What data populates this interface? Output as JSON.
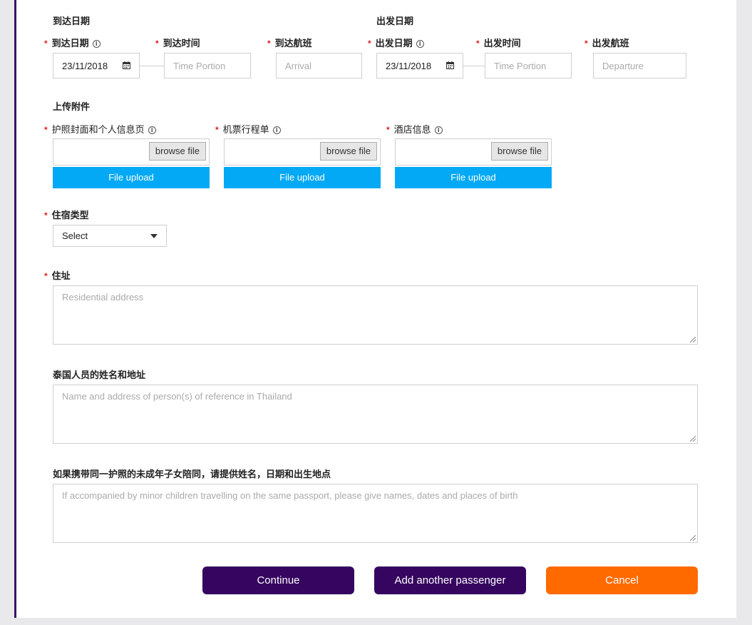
{
  "arrival": {
    "section_title": "到达日期",
    "date_label": "到达日期",
    "date_value": "23/11/2018",
    "time_label": "到达时间",
    "time_placeholder": "Time Portion",
    "flight_label": "到达航班",
    "flight_placeholder": "Arrival"
  },
  "departure": {
    "section_title": "出发日期",
    "date_label": "出发日期",
    "date_value": "23/11/2018",
    "time_label": "出发时间",
    "time_placeholder": "Time Portion",
    "flight_label": "出发航班",
    "flight_placeholder": "Departure"
  },
  "required_mark": "*",
  "info_glyph": "i",
  "attachments": {
    "section_title": "上传附件",
    "items": [
      {
        "label": "护照封面和个人信息页",
        "browse": "browse file",
        "upload": "File upload"
      },
      {
        "label": "机票行程单",
        "browse": "browse file",
        "upload": "File upload"
      },
      {
        "label": "酒店信息",
        "browse": "browse file",
        "upload": "File upload"
      }
    ]
  },
  "accommodation": {
    "label": "住宿类型",
    "selected": "Select"
  },
  "address": {
    "label": "住址",
    "placeholder": "Residential address"
  },
  "reference": {
    "label": "泰国人员的姓名和地址",
    "placeholder": "Name and address of person(s) of reference in Thailand"
  },
  "minors": {
    "label": "如果携带同一护照的未成年子女陪同，请提供姓名，日期和出生地点",
    "placeholder": "If accompanied by minor children travelling on the same passport, please give names, dates and places of birth"
  },
  "buttons": {
    "continue": "Continue",
    "add_passenger": "Add another passenger",
    "cancel": "Cancel"
  },
  "colors": {
    "accent_purple": "#35055f",
    "upload_blue": "#03a9f4",
    "cancel_orange": "#ff6a00",
    "required_red": "#e02020"
  }
}
